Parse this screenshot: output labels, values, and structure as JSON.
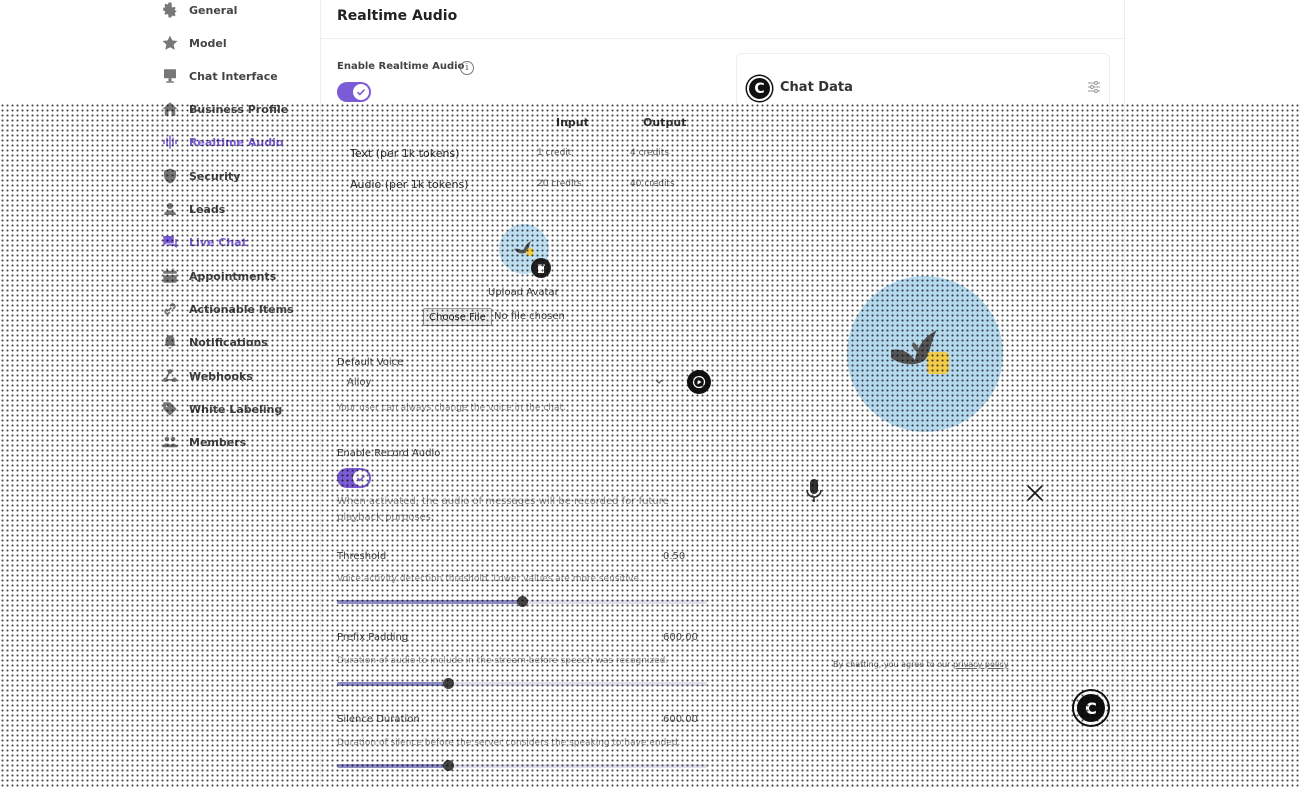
{
  "sidebar": {
    "items": [
      {
        "label": "General",
        "icon": "gear-icon"
      },
      {
        "label": "Model",
        "icon": "star-icon"
      },
      {
        "label": "Chat Interface",
        "icon": "monitor-icon"
      },
      {
        "label": "Business Profile",
        "icon": "home-icon"
      },
      {
        "label": "Realtime Audio",
        "icon": "audio-wave-icon",
        "active": true
      },
      {
        "label": "Security",
        "icon": "shield-icon"
      },
      {
        "label": "Leads",
        "icon": "users-icon"
      },
      {
        "label": "Live Chat",
        "icon": "chat-icon",
        "active": true
      },
      {
        "label": "Appointments",
        "icon": "calendar-icon"
      },
      {
        "label": "Actionable Items",
        "icon": "link-icon"
      },
      {
        "label": "Notifications",
        "icon": "bell-icon"
      },
      {
        "label": "Webhooks",
        "icon": "webhook-icon"
      },
      {
        "label": "White Labeling",
        "icon": "tag-icon"
      },
      {
        "label": "Members",
        "icon": "people-icon"
      }
    ]
  },
  "main": {
    "title": "Realtime Audio",
    "enable_realtime": {
      "label": "Enable Realtime Audio",
      "info": "i",
      "enabled": true
    },
    "pricing": {
      "headers": [
        "Input",
        "Output"
      ],
      "rows": [
        {
          "label": "Text (per 1k tokens)",
          "input": "1 credit",
          "output": "4 credits"
        },
        {
          "label": "Audio (per 1k tokens)",
          "input": "20 credits",
          "output": "40 credits"
        }
      ]
    },
    "avatar": {
      "upload_label": "Upload Avatar",
      "choose_file": "Choose File",
      "file_status": "No file chosen"
    },
    "default_voice": {
      "label": "Default Voice",
      "value": "Alloy",
      "help": "Your user can always change the voice in the chat."
    },
    "record_audio": {
      "label": "Enable Record Audio",
      "enabled": true,
      "help": "When activated, the audio of messages will be recorded for future playback purposes."
    },
    "threshold": {
      "label": "Threshold",
      "value": "0.50",
      "level": 0.5,
      "help": "Voice activity detection threshold. Lower values are more sensitive."
    },
    "prefix_padding": {
      "label": "Prefix Padding",
      "value": "600.00",
      "level": 0.3,
      "help": "Duration of audio to include in the stream before speech was recognized."
    },
    "silence_duration": {
      "label": "Silence Duration",
      "value": "600.00",
      "level": 0.3,
      "help": "Duration of silence before the server considers the speaking to have ended."
    }
  },
  "preview": {
    "logo_letter": "C",
    "title": "Chat Data",
    "terms_prefix": "By chatting, you agree to our ",
    "terms_link": "privacy policy",
    "fab_letter": "C"
  },
  "colors": {
    "accent": "#7c5cd6",
    "avatar_bg": "#b5d9ee"
  }
}
